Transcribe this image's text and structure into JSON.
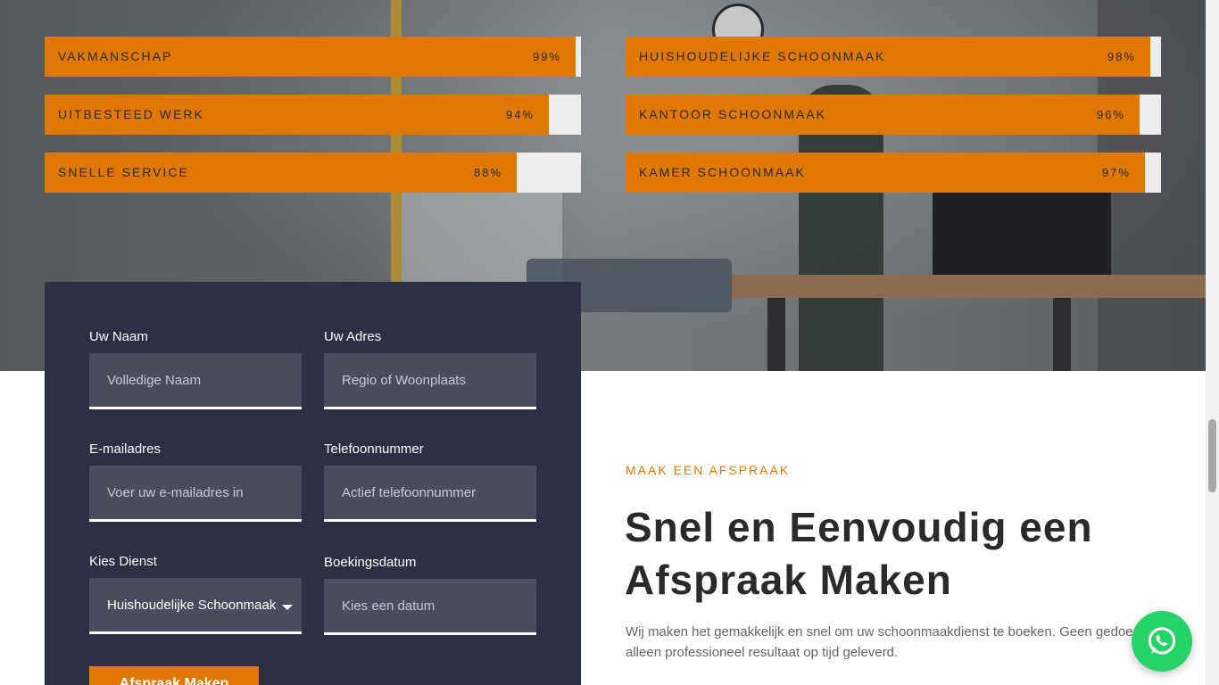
{
  "skills": {
    "left": [
      {
        "label": "VAKMANSCHAP",
        "percent_text": "99%",
        "value": 99
      },
      {
        "label": "UITBESTEED WERK",
        "percent_text": "94%",
        "value": 94
      },
      {
        "label": "SNELLE SERVICE",
        "percent_text": "88%",
        "value": 88
      }
    ],
    "right": [
      {
        "label": "HUISHOUDELIJKE SCHOONMAAK",
        "percent_text": "98%",
        "value": 98
      },
      {
        "label": "KANTOOR SCHOONMAAK",
        "percent_text": "96%",
        "value": 96
      },
      {
        "label": "KAMER SCHOONMAAK",
        "percent_text": "97%",
        "value": 97
      }
    ]
  },
  "form": {
    "name_label": "Uw Naam",
    "name_placeholder": "Volledige Naam",
    "address_label": "Uw Adres",
    "address_placeholder": "Regio of Woonplaats",
    "email_label": "E-mailadres",
    "email_placeholder": "Voer uw e-mailadres in",
    "phone_label": "Telefoonnummer",
    "phone_placeholder": "Actief telefoonnummer",
    "service_label": "Kies Dienst",
    "service_value": "Huishoudelijke Schoonmaak",
    "date_label": "Boekingsdatum",
    "date_placeholder": "Kies een datum",
    "submit_label": "Afspraak Maken"
  },
  "content": {
    "eyebrow": "MAAK EEN AFSPRAAK",
    "headline_line1": "Snel en Eenvoudig een",
    "headline_line2": "Afspraak Maken",
    "desc_line1": "Wij maken het gemakkelijk en snel om uw schoonmaakdienst te boeken. Geen gedoe,",
    "desc_line2": "alleen professioneel resultaat op tijd geleverd."
  },
  "colors": {
    "accent": "#e07800",
    "form_bg": "#2d2f44",
    "input_bg": "#4a4c5f",
    "whatsapp": "#25d366"
  },
  "icons": {
    "whatsapp": "whatsapp-icon",
    "select_caret": "chevron-down-icon"
  }
}
